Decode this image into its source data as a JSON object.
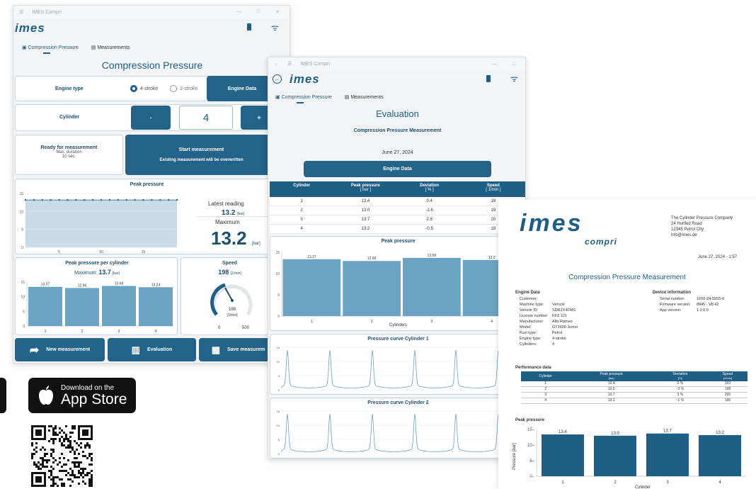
{
  "app": {
    "window_title": "IMES Compri",
    "logo": "imes"
  },
  "tabs": {
    "compression": "Compression Pressure",
    "measurements": "Measurements"
  },
  "win1": {
    "title": "Compression Pressure",
    "engine_type_label": "Engine type",
    "stroke4": "4-stroke",
    "stroke2": "2-stroke",
    "engine_data_btn": "Engine Data",
    "cylinder_label": "Cylinder",
    "minus": "-",
    "cylinder_value": "4",
    "plus": "+",
    "ready": "Ready for measurement",
    "max_duration": "Max. duration",
    "duration_value": "10 sec.",
    "start": "Start measurement",
    "overwrite": "Existing measurement will be overwritten",
    "peak_title": "Peak pressure",
    "latest_reading_label": "Latest reading",
    "latest_reading_value": "13.2",
    "unit_bar": "[bar]",
    "maximum_label": "Maximum",
    "maximum_value": "13.2",
    "per_cyl_title": "Peak pressure per cylinder",
    "per_cyl_max_label": "Maximum:",
    "per_cyl_max_value": "13.7",
    "speed_title": "Speed",
    "speed_value": "198",
    "speed_unit": "[1/min]",
    "gauge_min": "0",
    "gauge_max": "500",
    "gauge_value": "198",
    "new_measurement": "New measurement",
    "evaluation": "Evaluation",
    "save": "Save measurem"
  },
  "win2": {
    "title": "Evaluation",
    "subtitle": "Compression Pressure Measurement",
    "date": "June 27, 2024",
    "engine_data_btn": "Engine Data",
    "table_headers": [
      {
        "h": "Cylinder",
        "u": ""
      },
      {
        "h": "Peak pressure",
        "u": "[ bar ]"
      },
      {
        "h": "Deviation",
        "u": "[ % ]"
      },
      {
        "h": "Speed",
        "u": "[ 1/min ]"
      }
    ],
    "rows": [
      [
        "1",
        "13.4",
        "0.4",
        "19"
      ],
      [
        "2",
        "13.0",
        "-2.6",
        "19"
      ],
      [
        "3",
        "13.7",
        "2.8",
        "20"
      ],
      [
        "4",
        "13.2",
        "-0.5",
        "19"
      ]
    ],
    "peak_title": "Peak pressure",
    "x_label": "Cylinders",
    "curve1_title": "Pressure curve Cylinder 1",
    "curve2_title": "Pressure curve Cylinder 2"
  },
  "report": {
    "logo_main": "imes",
    "logo_sub": "compri",
    "company": [
      "The Cylinder Pressure Company",
      "24 Hurfled Road",
      "12345 Petrol City",
      "info@imes.de"
    ],
    "datetime": "June 27, 2024 - 1:57",
    "title": "Compression Pressure Measurement",
    "engine_data_title": "Engine Data",
    "engine_data": [
      [
        "Customer:",
        ""
      ],
      [
        "Machine type:",
        "Vehicle"
      ],
      [
        "Vehicle ID:",
        "SDR2X4FMS"
      ],
      [
        "License number:",
        "KFZ 121"
      ],
      [
        "Manufacturer:",
        "Alfa Romeo"
      ],
      [
        "Model:",
        "GT1600 Junior"
      ],
      [
        "Fuel type:",
        "Petrol"
      ],
      [
        "Engine type:",
        "4-stroke"
      ],
      [
        "Cylinders:",
        "4"
      ]
    ],
    "device_title": "Device information",
    "device": [
      [
        "Serial number:",
        "1650-24-5555-0"
      ],
      [
        "Firmware version:",
        "8945 - V8.42"
      ],
      [
        "App version:",
        "1.0.0.0"
      ]
    ],
    "perf_title": "Performance data",
    "perf_headers": [
      "Cylinder",
      "Peak pressure",
      "Deviation",
      "Speed"
    ],
    "perf_units": [
      "",
      "[bar]",
      "[%]",
      "[1/min]"
    ],
    "perf_rows": [
      [
        "1",
        "13.4",
        "0 %",
        "193"
      ],
      [
        "2",
        "13.0",
        "-3 %",
        "198"
      ],
      [
        "3",
        "13.7",
        "3 %",
        "205"
      ],
      [
        "4",
        "13.2",
        "-1 %",
        "196"
      ]
    ],
    "chart_title": "Peak pressure",
    "ylabel": "Pressure [bar]",
    "xlabel": "Cylinder"
  },
  "store": {
    "small": "Download on the",
    "big": "App Store"
  },
  "colors": {
    "primary": "#236289",
    "bar": "#6ba3c2",
    "bar_dark": "#1f5f86"
  },
  "chart_data": [
    {
      "type": "line",
      "title": "Peak pressure",
      "x": [
        1,
        2,
        3,
        4,
        5,
        6,
        7,
        8,
        9,
        10,
        11,
        12,
        13,
        14,
        15,
        16,
        17,
        18,
        19
      ],
      "values": [
        13.2,
        13.2,
        13.2,
        13.2,
        13.2,
        13.2,
        13.2,
        13.2,
        13.2,
        13.2,
        13.2,
        13.2,
        13.2,
        13.2,
        13.2,
        13.2,
        13.2,
        13.2,
        13.2
      ],
      "ylim": [
        0,
        15
      ],
      "xticks": [
        "5",
        "10",
        "15"
      ],
      "yticks": [
        "0",
        "5",
        "10",
        "15"
      ]
    },
    {
      "type": "bar",
      "title": "Peak pressure per cylinder",
      "categories": [
        "1",
        "2",
        "3",
        "4"
      ],
      "values": [
        13.37,
        12.96,
        13.68,
        13.24
      ],
      "labels": [
        "13.37",
        "12.96",
        "13.68",
        "13.24"
      ],
      "ylim": [
        0,
        15
      ]
    },
    {
      "type": "bar",
      "title": "Peak pressure",
      "categories": [
        "1",
        "2",
        "3",
        "4"
      ],
      "values": [
        13.37,
        12.96,
        13.68,
        13.2
      ],
      "labels": [
        "13.37",
        "12.96",
        "13.68",
        "13.2"
      ],
      "xlabel": "Cylinders",
      "ylim": [
        0,
        15
      ]
    },
    {
      "type": "bar",
      "title": "Peak pressure",
      "categories": [
        "1",
        "2",
        "3",
        "4"
      ],
      "values": [
        13.4,
        13.0,
        13.7,
        13.2
      ],
      "labels": [
        "13.4",
        "13.0",
        "13.7",
        "13.2"
      ],
      "xlabel": "Cylinder",
      "ylabel": "Pressure [bar]",
      "ylim": [
        0,
        15
      ],
      "yticks": [
        "0",
        "5",
        "10",
        "15"
      ]
    }
  ]
}
